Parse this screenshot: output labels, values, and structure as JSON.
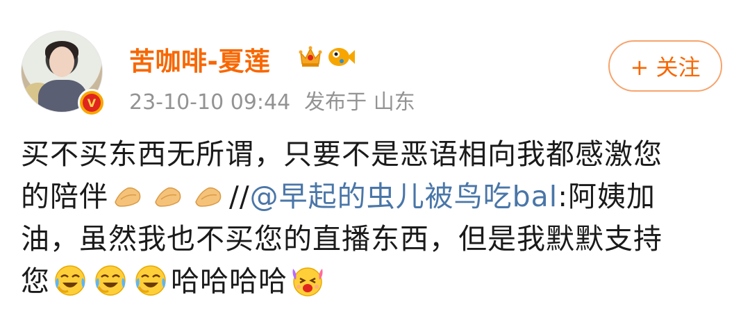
{
  "user": {
    "name": "苦咖啡-夏莲",
    "verified_icon": "verified-v-badge",
    "badges": [
      "crown-icon",
      "fish-icon"
    ],
    "avatar": "avatar-photo"
  },
  "meta": {
    "timestamp": "23-10-10 09:44",
    "location": "发布于 山东"
  },
  "follow": {
    "label": "+ 关注"
  },
  "post": {
    "line1": "买不买东西无所谓，只要不是恶语相向我都感激您",
    "line2_text": "的陪伴",
    "line2_sep": "//",
    "mention": "@早起的虫儿被鸟吃bal",
    "line2_tail": ":阿姨加",
    "line3": "油，虽然我也不买您的直播东西，但是我默默支持",
    "line4_start": "您",
    "line4_text": "哈哈哈哈",
    "emojis": {
      "pray": "praying-hands-icon",
      "laugh_cry": "laughing-crying-icon",
      "excited": "excited-face-icon"
    }
  },
  "colors": {
    "username": "#f86700",
    "meta": "#939393",
    "link": "#4a76a8",
    "text": "#1a1a1a",
    "follow_border": "#f7a36b"
  }
}
